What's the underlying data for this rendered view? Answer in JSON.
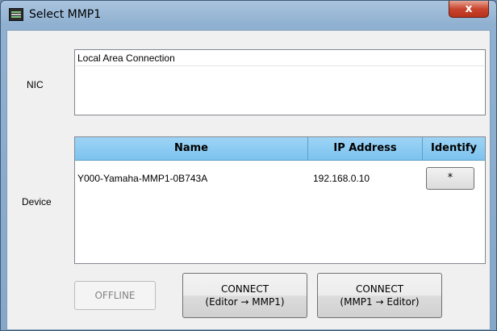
{
  "window": {
    "title": "Select MMP1",
    "close_glyph": "x"
  },
  "nic": {
    "label": "NIC",
    "items": [
      "Local Area Connection"
    ]
  },
  "device": {
    "label": "Device",
    "columns": [
      "Name",
      "IP Address",
      "Identify"
    ],
    "rows": [
      {
        "name": "Y000-Yamaha-MMP1-0B743A",
        "ip": "192.168.0.10",
        "identify": "*"
      }
    ]
  },
  "buttons": {
    "offline": "OFFLINE",
    "connect_editor_to_mmp1": {
      "line1": "CONNECT",
      "line2": "(Editor → MMP1)"
    },
    "connect_mmp1_to_editor": {
      "line1": "CONNECT",
      "line2": "(MMP1 → Editor)"
    }
  },
  "colors": {
    "header_blue": "#8fcdf3",
    "close_red": "#c9452e"
  },
  "icons": [
    "app-icon",
    "close-icon"
  ]
}
